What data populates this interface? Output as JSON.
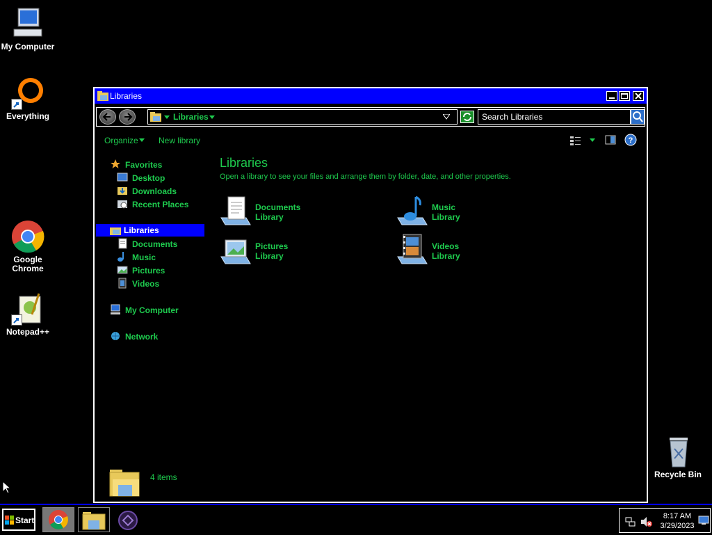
{
  "desktop": {
    "icons": [
      {
        "label": "My Computer"
      },
      {
        "label": "Everything"
      },
      {
        "label": "Google Chrome"
      },
      {
        "label": "Notepad++"
      },
      {
        "label": "Recycle Bin"
      }
    ]
  },
  "window": {
    "title": "Libraries",
    "address_crumb": "Libraries",
    "search_placeholder": "Search Libraries",
    "toolbar": {
      "organize": "Organize",
      "new_library": "New library"
    },
    "nav": {
      "favorites": "Favorites",
      "desktop": "Desktop",
      "downloads": "Downloads",
      "recent_places": "Recent Places",
      "libraries": "Libraries",
      "documents": "Documents",
      "music": "Music",
      "pictures": "Pictures",
      "videos": "Videos",
      "my_computer": "My Computer",
      "network": "Network"
    },
    "content": {
      "title": "Libraries",
      "description": "Open a library to see your files and arrange them by folder, date, and other properties.",
      "libraries": [
        {
          "name": "Documents",
          "sub": "Library"
        },
        {
          "name": "Music",
          "sub": "Library"
        },
        {
          "name": "Pictures",
          "sub": "Library"
        },
        {
          "name": "Videos",
          "sub": "Library"
        }
      ]
    },
    "status": {
      "items": "4 items"
    }
  },
  "taskbar": {
    "start_label": "Start",
    "clock_time": "8:17 AM",
    "clock_date": "3/29/2023"
  },
  "colors": {
    "accent": "#0000ff",
    "text_green": "#1ecb4e"
  }
}
